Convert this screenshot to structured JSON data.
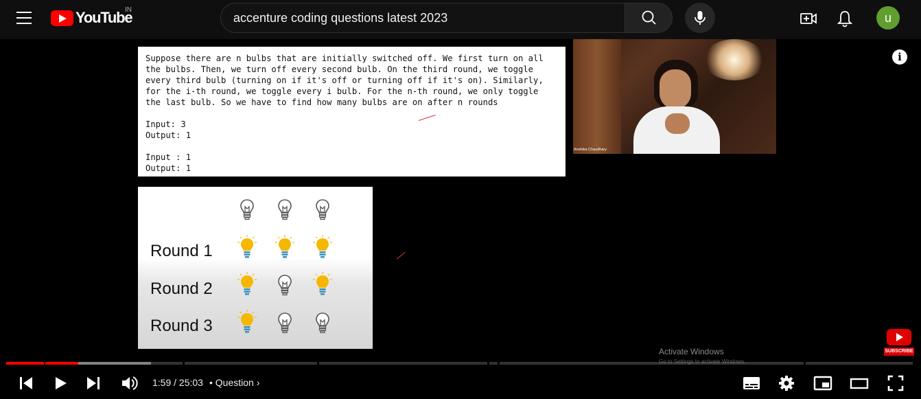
{
  "header": {
    "logo_text": "YouTube",
    "country_code": "IN",
    "search_value": "accenture coding questions latest 2023",
    "avatar_letter": "u"
  },
  "problem": {
    "lines": [
      "Suppose there are n bulbs that are initially switched off. We first turn on all",
      "the bulbs. Then, we turn off every second bulb. On the third round, we toggle",
      "every third bulb (turning on if it's off or turning off if it's on). Similarly,",
      "for the i-th round, we toggle every i bulb. For the n-th round, we only toggle",
      "the last bulb. So we have to find how many bulbs are on after n rounds"
    ],
    "example1_input": "Input: 3",
    "example1_output": "Output: 1",
    "example2_input": "Input : 1",
    "example2_output": "Output: 1"
  },
  "webcam": {
    "presenter_name": "Anshika Chaudhary"
  },
  "bulbs": {
    "rounds": [
      {
        "label": "",
        "states": [
          "off",
          "off",
          "off"
        ]
      },
      {
        "label": "Round 1",
        "states": [
          "on",
          "on",
          "on"
        ]
      },
      {
        "label": "Round 2",
        "states": [
          "on",
          "off",
          "on"
        ]
      },
      {
        "label": "Round 3",
        "states": [
          "on",
          "off",
          "off"
        ]
      }
    ],
    "on_color": "#f5b700",
    "off_color": "#555555"
  },
  "watermark": {
    "line1": "Activate Windows",
    "line2": "Go to Settings to activate Windows."
  },
  "subscribe_label": "SUBSCRIBE",
  "player": {
    "current_time": "1:59",
    "duration": "25:03",
    "time_display": "1:59 / 25:03",
    "chapter_title": "Question",
    "played_color": "#ff0000"
  }
}
